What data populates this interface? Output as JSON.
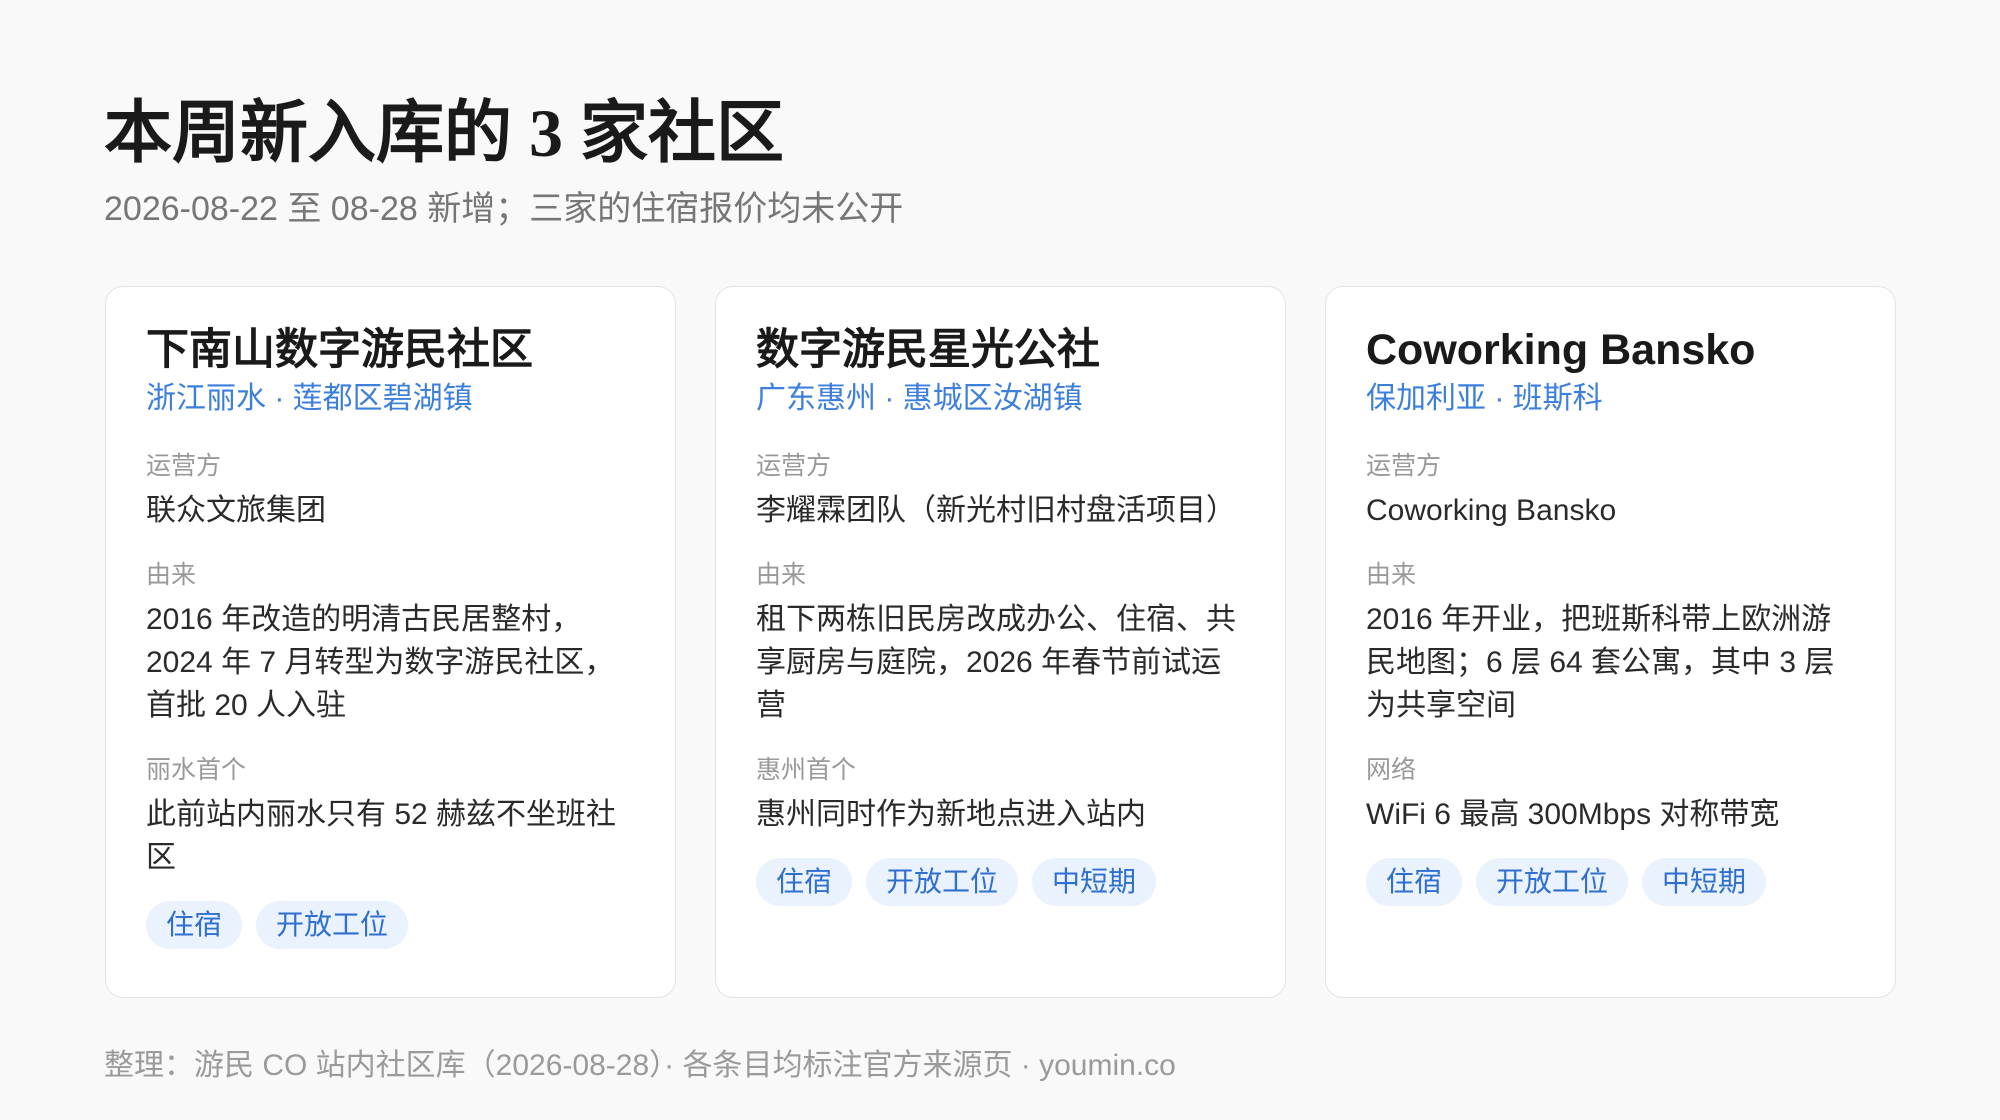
{
  "header": {
    "title": "本周新入库的 3 家社区",
    "subtitle": "2026-08-22 至 08-28 新增；三家的住宿报价均未公开"
  },
  "cards": [
    {
      "name": "下南山数字游民社区",
      "location": "浙江丽水 · 莲都区碧湖镇",
      "fields": [
        {
          "label": "运营方",
          "value": "联众文旅集团"
        },
        {
          "label": "由来",
          "value": "2016 年改造的明清古民居整村，2024 年 7 月转型为数字游民社区，首批 20 人入驻"
        },
        {
          "label": "丽水首个",
          "value": "此前站内丽水只有 52 赫兹不坐班社区"
        }
      ],
      "tags": [
        "住宿",
        "开放工位"
      ]
    },
    {
      "name": "数字游民星光公社",
      "location": "广东惠州 · 惠城区汝湖镇",
      "fields": [
        {
          "label": "运营方",
          "value": "李耀霖团队（新光村旧村盘活项目）"
        },
        {
          "label": "由来",
          "value": "租下两栋旧民房改成办公、住宿、共享厨房与庭院，2026 年春节前试运营"
        },
        {
          "label": "惠州首个",
          "value": "惠州同时作为新地点进入站内"
        }
      ],
      "tags": [
        "住宿",
        "开放工位",
        "中短期"
      ]
    },
    {
      "name": "Coworking Bansko",
      "location": "保加利亚 · 班斯科",
      "fields": [
        {
          "label": "运营方",
          "value": "Coworking Bansko"
        },
        {
          "label": "由来",
          "value": "2016 年开业，把班斯科带上欧洲游民地图；6 层 64 套公寓，其中 3 层为共享空间"
        },
        {
          "label": "网络",
          "value": "WiFi 6 最高 300Mbps 对称带宽"
        }
      ],
      "tags": [
        "住宿",
        "开放工位",
        "中短期"
      ]
    }
  ],
  "footer": {
    "text": "整理：游民 CO 站内社区库（2026-08-28）· 各条目均标注官方来源页 · youmin.co"
  }
}
